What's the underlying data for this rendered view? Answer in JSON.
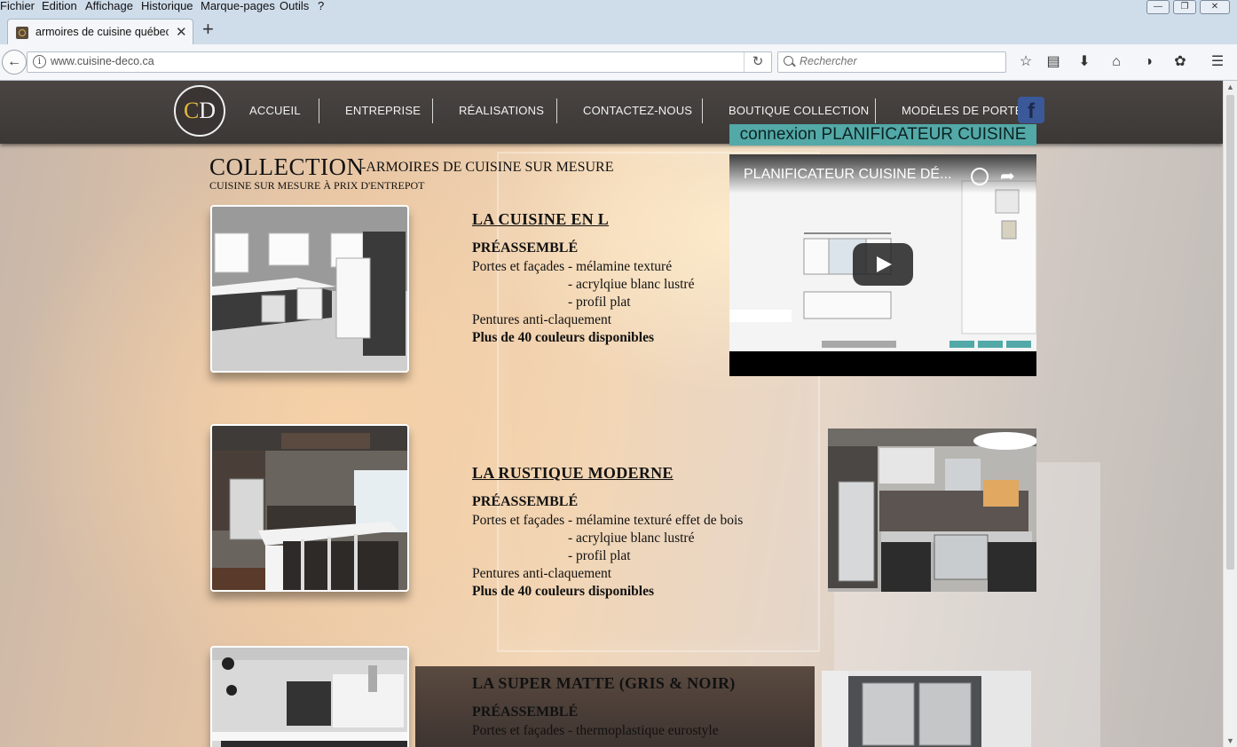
{
  "browser": {
    "menu": [
      "Fichier",
      "Edition",
      "Affichage",
      "Historique",
      "Marque-pages",
      "Outils",
      "?"
    ],
    "tab_title": "armoires de cuisine québec c",
    "url": "www.cuisine-deco.ca",
    "search_placeholder": "Rechercher"
  },
  "site": {
    "logo_c": "C",
    "logo_d": "D",
    "nav": [
      "ACCUEIL",
      "ENTREPRISE",
      "RÉALISATIONS",
      "CONTACTEZ-NOUS",
      "BOUTIQUE COLLECTION",
      "MODÈLES DE PORTE"
    ],
    "planner_link": "connexion PLANIFICATEUR CUISINE",
    "collection_title": "COLLECTION",
    "collection_subtitle": "-ARMOIRES DE CUISINE SUR MESURE",
    "collection_tagline": "CUISINE SUR MESURE À PRIX D'ENTREPOT"
  },
  "kitchens": [
    {
      "title": "LA  CUISINE EN L",
      "preassembled": "PRÉASSEMBLÉ",
      "doors": "Portes et façades - mélamine texturé",
      "opt1": "- acrylqiue blanc lustré",
      "opt2": "- profil plat",
      "hinges": "Pentures anti-claquement",
      "colors": "Plus de 40 couleurs disponibles"
    },
    {
      "title": "LA  RUSTIQUE MODERNE",
      "preassembled": "PRÉASSEMBLÉ",
      "doors": "Portes et façades - mélamine texturé effet de bois",
      "opt1": "- acrylqiue blanc lustré",
      "opt2": "- profil plat",
      "hinges": "Pentures anti-claquement",
      "colors": "Plus de 40 couleurs disponibles"
    },
    {
      "title": "LA SUPER MATTE (GRIS & NOIR)",
      "preassembled": "PRÉASSEMBLÉ",
      "doors": "Portes et façades - thermoplastique eurostyle"
    }
  ],
  "video": {
    "title": "PLANIFICATEUR CUISINE DÉ..."
  }
}
